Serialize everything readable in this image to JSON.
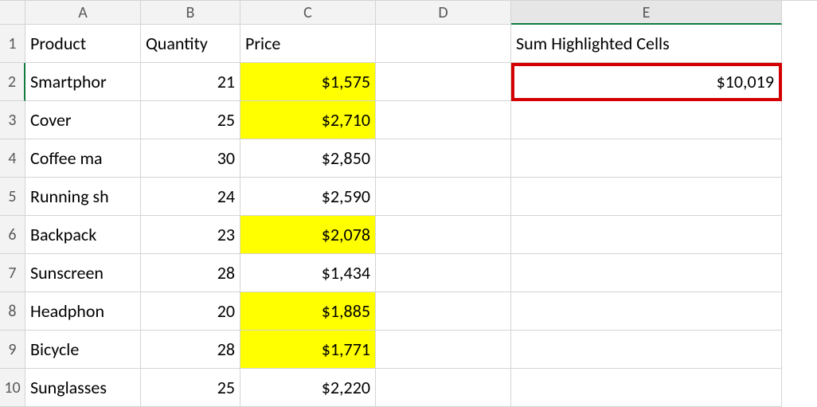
{
  "chart_data": {
    "type": "table",
    "columns": [
      "Product",
      "Quantity",
      "Price"
    ],
    "rows": [
      {
        "product": "Smartphone",
        "quantity": 21,
        "price": 1575,
        "highlighted": true
      },
      {
        "product": "Cover",
        "quantity": 25,
        "price": 2710,
        "highlighted": true
      },
      {
        "product": "Coffee maker",
        "quantity": 30,
        "price": 2850,
        "highlighted": false
      },
      {
        "product": "Running shoes",
        "quantity": 24,
        "price": 2590,
        "highlighted": false
      },
      {
        "product": "Backpack",
        "quantity": 23,
        "price": 2078,
        "highlighted": true
      },
      {
        "product": "Sunscreen",
        "quantity": 28,
        "price": 1434,
        "highlighted": false
      },
      {
        "product": "Headphones",
        "quantity": 20,
        "price": 1885,
        "highlighted": true
      },
      {
        "product": "Bicycle",
        "quantity": 28,
        "price": 1771,
        "highlighted": true
      },
      {
        "product": "Sunglasses",
        "quantity": 25,
        "price": 2220,
        "highlighted": false
      }
    ],
    "sum_highlighted": 10019
  },
  "columns": {
    "A": "A",
    "B": "B",
    "C": "C",
    "D": "D",
    "E": "E"
  },
  "rowNumbers": [
    "1",
    "2",
    "3",
    "4",
    "5",
    "6",
    "7",
    "8",
    "9",
    "10"
  ],
  "headers": {
    "product": "Product",
    "quantity": "Quantity",
    "price": "Price",
    "sumLabel": "Sum Highlighted Cells"
  },
  "rows": [
    {
      "product": "Smartphor",
      "quantity": "21",
      "price": "$1,575",
      "highlight": true
    },
    {
      "product": "Cover",
      "quantity": "25",
      "price": "$2,710",
      "highlight": true
    },
    {
      "product": "Coffee ma",
      "quantity": "30",
      "price": "$2,850",
      "highlight": false
    },
    {
      "product": "Running sh",
      "quantity": "24",
      "price": "$2,590",
      "highlight": false
    },
    {
      "product": "Backpack",
      "quantity": "23",
      "price": "$2,078",
      "highlight": true
    },
    {
      "product": "Sunscreen",
      "quantity": "28",
      "price": "$1,434",
      "highlight": false
    },
    {
      "product": "Headphon",
      "quantity": "20",
      "price": "$1,885",
      "highlight": true
    },
    {
      "product": "Bicycle",
      "quantity": "28",
      "price": "$1,771",
      "highlight": true
    },
    {
      "product": "Sunglasses",
      "quantity": "25",
      "price": "$2,220",
      "highlight": false
    }
  ],
  "sumValue": "$10,019"
}
